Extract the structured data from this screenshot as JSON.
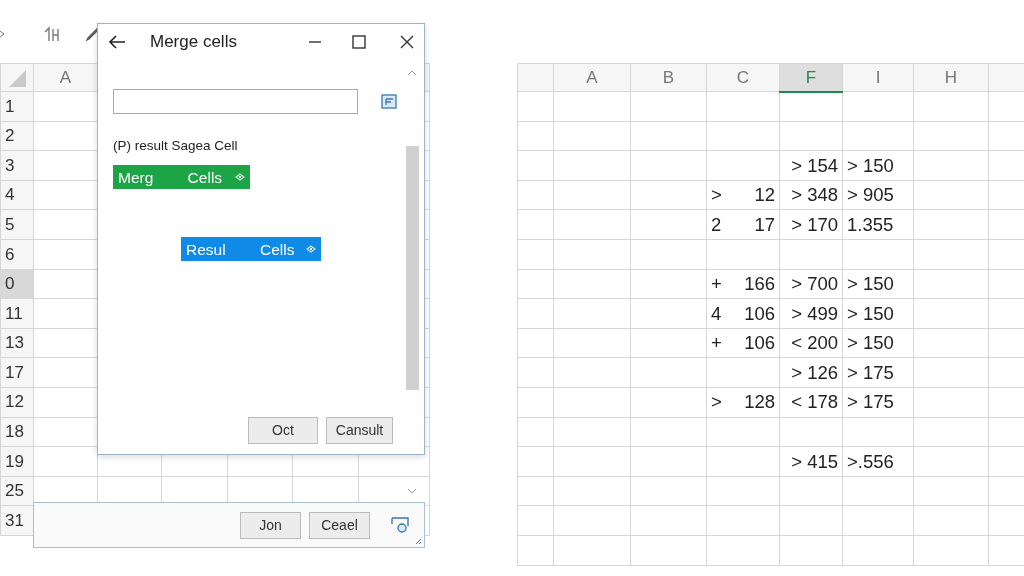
{
  "left_sheet": {
    "columns": [
      "A"
    ],
    "rows": [
      {
        "label": "1",
        "selected": false
      },
      {
        "label": "2",
        "selected": false
      },
      {
        "label": "3",
        "selected": false
      },
      {
        "label": "4",
        "selected": false
      },
      {
        "label": "5",
        "selected": false
      },
      {
        "label": "6",
        "selected": false
      },
      {
        "label": "0",
        "selected": true
      },
      {
        "label": "11",
        "selected": false
      },
      {
        "label": "13",
        "selected": false
      },
      {
        "label": "17",
        "selected": false
      },
      {
        "label": "12",
        "selected": false
      },
      {
        "label": "18",
        "selected": false
      },
      {
        "label": "19",
        "selected": false
      },
      {
        "label": "25",
        "selected": false
      },
      {
        "label": "31",
        "selected": false
      }
    ]
  },
  "dialog": {
    "title": "Merge cells",
    "label": "(P) result Sagea Cell",
    "actions": [
      {
        "label": "Merg Cells",
        "color": "#1ca446"
      },
      {
        "label": "Resul Cells",
        "color": "#0f8ae6"
      }
    ],
    "buttons": [
      "Oct",
      "Cansult"
    ]
  },
  "bottom_panel": {
    "buttons": [
      "Jon",
      "Ceael"
    ]
  },
  "right_sheet": {
    "columns": [
      {
        "label": "A",
        "selected": false
      },
      {
        "label": "B",
        "selected": false
      },
      {
        "label": "C",
        "selected": false
      },
      {
        "label": "F",
        "selected": true
      },
      {
        "label": "I",
        "selected": false
      },
      {
        "label": "H",
        "selected": false
      }
    ],
    "rows": [
      {},
      {},
      {
        "f": "> 154",
        "i": "> 150"
      },
      {
        "c_prefix": ">",
        "c": "12",
        "f": "> 348",
        "i": "> 905"
      },
      {
        "c_prefix": "2",
        "c": "17",
        "f": "> 170",
        "i": "1.355"
      },
      {},
      {
        "c_prefix": "+",
        "c": "166",
        "f": "> 700",
        "i": "> 150"
      },
      {
        "c_prefix": "4",
        "c": "106",
        "f": "> 499",
        "i": "> 150"
      },
      {
        "c_prefix": "+",
        "c": "106",
        "f": "< 200",
        "i": "> 150"
      },
      {
        "f": "> 126",
        "i": "> 175"
      },
      {
        "c_prefix": ">",
        "c": "128",
        "f": "< 178",
        "i": "> 175"
      },
      {},
      {
        "f": "> 415",
        "i": ">.556"
      },
      {},
      {},
      {}
    ]
  }
}
